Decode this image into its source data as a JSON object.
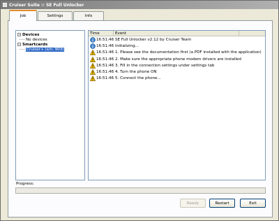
{
  "window": {
    "title": "Cruiser Suite :: SE Full Unlocker"
  },
  "tabs": [
    {
      "label": "Job",
      "active": true
    },
    {
      "label": "Settings",
      "active": false
    },
    {
      "label": "Info",
      "active": false
    }
  ],
  "tree": {
    "groups": [
      {
        "label": "Devices",
        "expander": "−",
        "children": [
          "No devices"
        ]
      },
      {
        "label": "Smartcards",
        "expander": "−",
        "children": [
          "Cruiser+ (s/n: 903)"
        ]
      }
    ],
    "selected_child": "Cruiser+ (s/n: 903)"
  },
  "log": {
    "columns": {
      "time": "Time",
      "event": "Event"
    },
    "rows": [
      {
        "icon": "info-icon",
        "time": "16:51:46",
        "event": "SE Full Unlocker v2.12 by Cruiser Team"
      },
      {
        "icon": "info-icon",
        "time": "16:51:46",
        "event": "Initializing..."
      },
      {
        "icon": "warning-icon",
        "time": "16:51:46",
        "event": "1. Please see the documentation first (a PDF installed with the application)"
      },
      {
        "icon": "warning-icon",
        "time": "16:51:46",
        "event": "2. Make sure the appropriate phone modem drivers are installed"
      },
      {
        "icon": "warning-icon",
        "time": "16:51:46",
        "event": "3. Fill in the connection settings under settings tab"
      },
      {
        "icon": "warning-icon",
        "time": "16:51:46",
        "event": "4. Turn the phone ON"
      },
      {
        "icon": "warning-icon",
        "time": "16:51:46",
        "event": "5. Connect the phone..."
      }
    ]
  },
  "progress": {
    "label": "Progress:",
    "value": 0
  },
  "buttons": {
    "ready": {
      "label": "Ready",
      "enabled": false
    },
    "restart": {
      "label": "Restart",
      "enabled": true
    },
    "exit": {
      "label": "Exit",
      "enabled": true
    }
  },
  "colors": {
    "selection": "#316ac5",
    "active_tab_accent": "#e68b2c",
    "warning": "#f2c200",
    "info": "#3c7fc8"
  }
}
